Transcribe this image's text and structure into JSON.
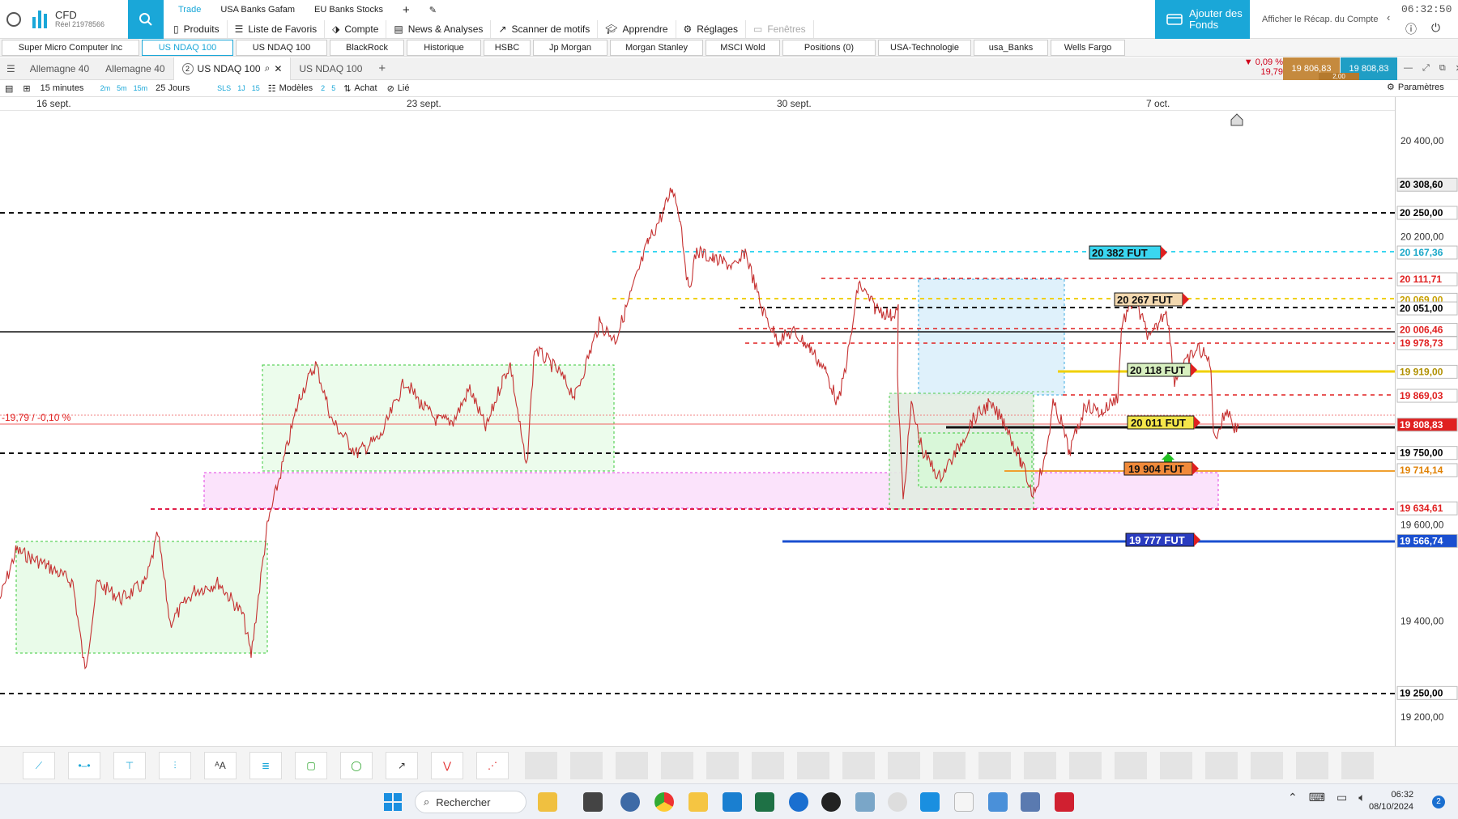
{
  "account": {
    "type": "CFD",
    "label": "Réel 21978566"
  },
  "top_tabs": [
    "Trade",
    "USA Banks Gafam",
    "EU Banks Stocks"
  ],
  "main_menu": [
    {
      "label": "Produits",
      "icon": "products-icon"
    },
    {
      "label": "Liste de Favoris",
      "icon": "list-icon"
    },
    {
      "label": "Compte",
      "icon": "tag-icon"
    },
    {
      "label": "News & Analyses",
      "icon": "news-icon"
    },
    {
      "label": "Scanner de motifs",
      "icon": "pattern-scanner-icon"
    },
    {
      "label": "Apprendre",
      "icon": "graduation-cap-icon"
    },
    {
      "label": "Réglages",
      "icon": "gear-icon"
    },
    {
      "label": "Fenêtres",
      "icon": "windows-icon"
    }
  ],
  "add_funds": "Ajouter des Fonds",
  "recap": "Afficher le Récap. du Compte",
  "clock": "06:32:50",
  "favorites": [
    "Super Micro Computer Inc",
    "US NDAQ 100",
    "US NDAQ 100",
    "BlackRock",
    "Historique",
    "HSBC",
    "Jp Morgan",
    "Morgan Stanley",
    "MSCI Wold",
    "Positions (0)",
    "USA-Technologie",
    "usa_Banks",
    "Wells Fargo"
  ],
  "chart_tabs": [
    "Allemagne 40",
    "Allemagne 40",
    "US NDAQ 100",
    "US NDAQ 100"
  ],
  "chart_tab_badge": "2",
  "quote": {
    "change_pct": "▼ 0,09 %",
    "change_abs": "19,79",
    "sell": "19 806,83",
    "buy": "19 808,83",
    "spread": "2,00"
  },
  "toolbar": {
    "interval": "15 minutes",
    "intervals": [
      "2m",
      "5m",
      "15m"
    ],
    "range": "25 Jours",
    "btns": [
      "SLS",
      "1J",
      "15"
    ],
    "models": "Modèles",
    "model_nums": [
      "2",
      "5"
    ],
    "buy": "Achat",
    "linked": "Lié",
    "params": "Paramètres"
  },
  "dates": [
    "16 sept.",
    "23 sept.",
    "30 sept.",
    "7 oct."
  ],
  "price_axis": {
    "plain_ticks": [
      "20 400,00",
      "20 200,00",
      "19 600,00",
      "19 400,00",
      "19 200,00"
    ],
    "tags": [
      {
        "text": "20 308,60",
        "bg": "#eeeeee",
        "fg": "#000000"
      },
      {
        "text": "20 250,00",
        "bg": "#ffffff",
        "fg": "#000000"
      },
      {
        "text": "20 167,36",
        "bg": "#ffffff",
        "fg": "#1aa7c8"
      },
      {
        "text": "20 111,71",
        "bg": "#ffffff",
        "fg": "#e02020"
      },
      {
        "text": "20 069,00",
        "bg": "#ffffff",
        "fg": "#c8a000"
      },
      {
        "text": "20 051,00",
        "bg": "#ffffff",
        "fg": "#000000"
      },
      {
        "text": "20 006,46",
        "bg": "#ffffff",
        "fg": "#e02020"
      },
      {
        "text": "19 978,73",
        "bg": "#ffffff",
        "fg": "#e02020"
      },
      {
        "text": "19 919,00",
        "bg": "#ffffff",
        "fg": "#b09000"
      },
      {
        "text": "19 869,03",
        "bg": "#ffffff",
        "fg": "#e02020"
      },
      {
        "text": "19 808,83",
        "bg": "#e02020",
        "fg": "#ffffff"
      },
      {
        "text": "19 750,00",
        "bg": "#ffffff",
        "fg": "#000000"
      },
      {
        "text": "19 714,14",
        "bg": "#ffffff",
        "fg": "#e08000"
      },
      {
        "text": "19 634,61",
        "bg": "#ffffff",
        "fg": "#e02020"
      },
      {
        "text": "19 566,74",
        "bg": "#1a4fd0",
        "fg": "#ffffff"
      },
      {
        "text": "19 250,00",
        "bg": "#ffffff",
        "fg": "#000000"
      }
    ]
  },
  "chart_labels": {
    "change_label": "-19,79 / -0,10 %",
    "fut_tags": [
      {
        "text": "20 382 FUT",
        "bg": "#3ad6f0"
      },
      {
        "text": "20 267 FUT",
        "bg": "#f3d9b0"
      },
      {
        "text": "20 118 FUT",
        "bg": "#d8f0c0"
      },
      {
        "text": "20 011 FUT",
        "bg": "#f4e64a"
      },
      {
        "text": "19 904 FUT",
        "bg": "#f08a3a"
      },
      {
        "text": "19 777 FUT",
        "bg": "#2a3cc0"
      }
    ]
  },
  "taskbar": {
    "search": "Rechercher",
    "time": "06:32",
    "date": "08/10/2024",
    "notifications": "2"
  },
  "colors": {
    "accent": "#1aa7d8",
    "down": "#d0021b",
    "sell": "#c58a3e",
    "buy": "#1f9ec5"
  }
}
